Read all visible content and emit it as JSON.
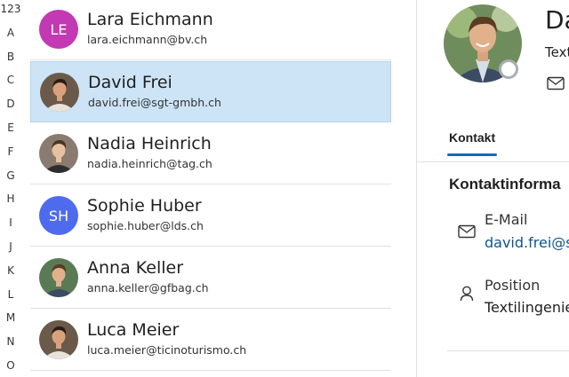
{
  "alphabet": [
    "123",
    "A",
    "B",
    "C",
    "D",
    "E",
    "F",
    "G",
    "H",
    "I",
    "J",
    "K",
    "L",
    "M",
    "N",
    "O"
  ],
  "contacts": [
    {
      "name": "Lara Eichmann",
      "email": "lara.eichmann@bv.ch",
      "initials": "LE",
      "avatar_color": "#c239b3",
      "photo": false
    },
    {
      "name": "David Frei",
      "email": "david.frei@sgt-gmbh.ch",
      "initials": "",
      "avatar_color": "#5a7a55",
      "photo": true
    },
    {
      "name": "Nadia Heinrich",
      "email": "nadia.heinrich@tag.ch",
      "initials": "",
      "avatar_color": "#6b5a4a",
      "photo": true
    },
    {
      "name": "Sophie Huber",
      "email": "sophie.huber@lds.ch",
      "initials": "SH",
      "avatar_color": "#4f6bed",
      "photo": false
    },
    {
      "name": "Anna Keller",
      "email": "anna.keller@gfbag.ch",
      "initials": "",
      "avatar_color": "#8a7b70",
      "photo": true
    },
    {
      "name": "Luca Meier",
      "email": "luca.meier@ticinoturismo.ch",
      "initials": "",
      "avatar_color": "#7fa0b8",
      "photo": true
    }
  ],
  "selected_index": 1,
  "detail": {
    "name": "Da",
    "subtitle": "Text",
    "tab_label": "Kontakt",
    "section_title": "Kontaktinforma",
    "email_label": "E-Mail",
    "email_value": "david.frei@s",
    "position_label": "Position",
    "position_value": "Textilingenie"
  },
  "colors": {
    "selection": "#cde4f7",
    "accent": "#0f6cbd",
    "link": "#0f548c"
  }
}
